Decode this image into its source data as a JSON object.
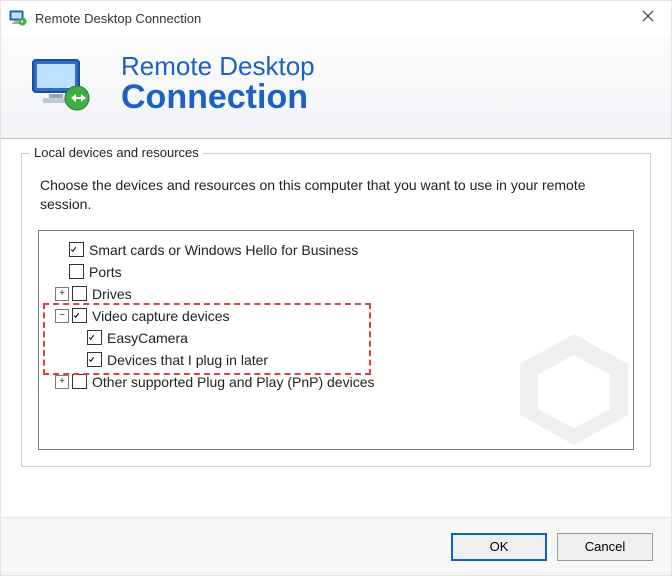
{
  "window": {
    "title": "Remote Desktop Connection"
  },
  "banner": {
    "line1": "Remote Desktop",
    "line2": "Connection"
  },
  "group": {
    "label": "Local devices and resources",
    "instruction": "Choose the devices and resources on this computer that you want to use in your remote session."
  },
  "tree": {
    "smart_cards": {
      "label": "Smart cards or Windows Hello for Business",
      "checked": true
    },
    "ports": {
      "label": "Ports",
      "checked": false
    },
    "drives": {
      "label": "Drives",
      "checked": false,
      "expand": "plus"
    },
    "video": {
      "label": "Video capture devices",
      "checked": true,
      "expand": "minus"
    },
    "video_children": {
      "easycam": {
        "label": "EasyCamera",
        "checked": true
      },
      "later": {
        "label": "Devices that I plug in later",
        "checked": true
      }
    },
    "pnp": {
      "label": "Other supported Plug and Play (PnP) devices",
      "checked": false,
      "expand": "plus"
    }
  },
  "buttons": {
    "ok": "OK",
    "cancel": "Cancel"
  }
}
